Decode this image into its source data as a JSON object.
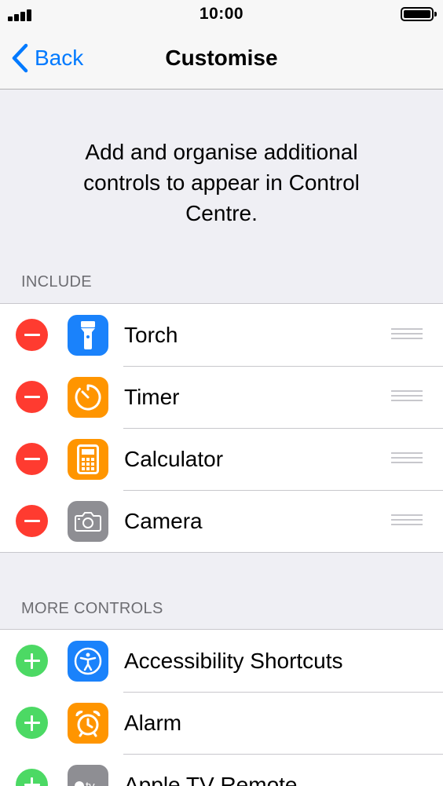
{
  "status_bar": {
    "time": "10:00"
  },
  "nav": {
    "back_label": "Back",
    "title": "Customise"
  },
  "intro_text": "Add and organise additional controls to appear in Control Centre.",
  "include": {
    "header": "INCLUDE",
    "items": [
      {
        "label": "Torch",
        "icon": "torch-icon",
        "icon_color": "#1a82fb",
        "action": "remove"
      },
      {
        "label": "Timer",
        "icon": "timer-icon",
        "icon_color": "#ff9500",
        "action": "remove"
      },
      {
        "label": "Calculator",
        "icon": "calculator-icon",
        "icon_color": "#ff9500",
        "action": "remove"
      },
      {
        "label": "Camera",
        "icon": "camera-icon",
        "icon_color": "#8e8e93",
        "action": "remove"
      }
    ]
  },
  "more_controls": {
    "header": "MORE CONTROLS",
    "items": [
      {
        "label": "Accessibility Shortcuts",
        "icon": "accessibility-icon",
        "icon_color": "#1a82fb",
        "action": "add"
      },
      {
        "label": "Alarm",
        "icon": "alarm-icon",
        "icon_color": "#ff9500",
        "action": "add"
      },
      {
        "label": "Apple TV Remote",
        "icon": "apple-tv-icon",
        "icon_color": "#8e8e93",
        "action": "add"
      }
    ]
  },
  "colors": {
    "accent": "#007aff",
    "remove": "#ff3b30",
    "add": "#4cd964",
    "background": "#efeff4"
  }
}
